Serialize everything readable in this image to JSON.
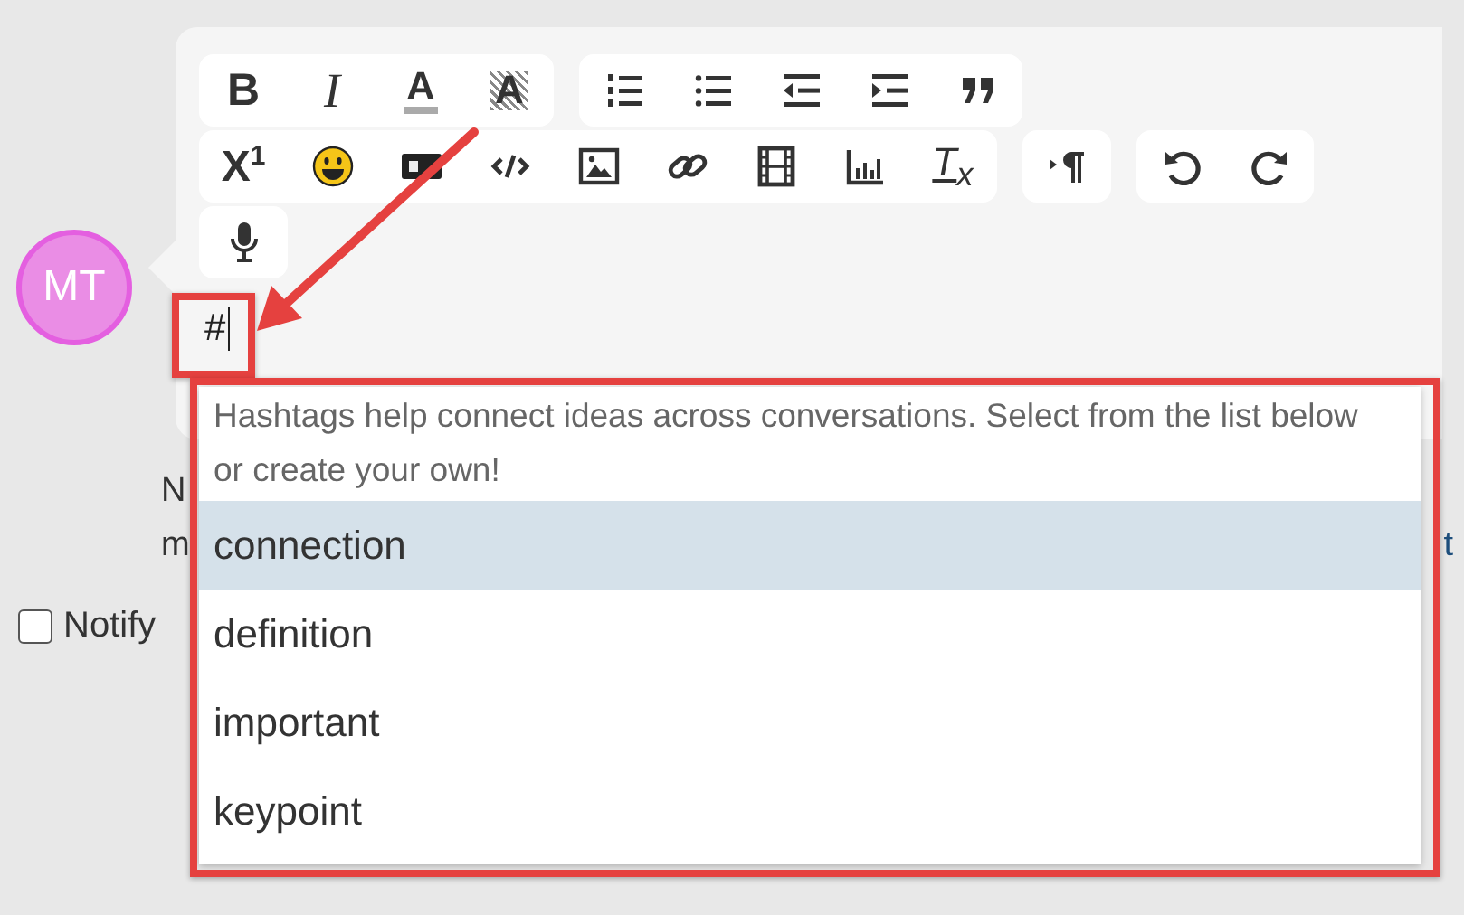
{
  "avatar": {
    "initials": "MT"
  },
  "toolbar": {
    "rows": [
      [
        {
          "buttons": [
            {
              "kind": "bold",
              "label": "B"
            },
            {
              "kind": "italic",
              "label": "I"
            },
            {
              "kind": "font-color",
              "label": "A"
            },
            {
              "kind": "highlight",
              "label": "A"
            }
          ]
        },
        {
          "buttons": [
            {
              "kind": "ordered-list"
            },
            {
              "kind": "bullet-list"
            },
            {
              "kind": "outdent"
            },
            {
              "kind": "indent"
            },
            {
              "kind": "quote"
            }
          ]
        }
      ],
      [
        {
          "buttons": [
            {
              "kind": "superscript",
              "label": "X$^{1}$"
            },
            {
              "kind": "emoji"
            },
            {
              "kind": "gif"
            },
            {
              "kind": "code"
            },
            {
              "kind": "image"
            },
            {
              "kind": "link"
            },
            {
              "kind": "video"
            },
            {
              "kind": "chart"
            },
            {
              "kind": "clear-format",
              "label": "T$_{x}$"
            }
          ]
        },
        {
          "buttons": [
            {
              "kind": "paragraph"
            }
          ]
        },
        {
          "buttons": [
            {
              "kind": "undo"
            },
            {
              "kind": "redo"
            }
          ]
        }
      ],
      [
        {
          "buttons": [
            {
              "kind": "microphone"
            }
          ]
        }
      ]
    ]
  },
  "composer": {
    "value": "#"
  },
  "background_text": {
    "line_1": "N",
    "line_2_start": "m",
    "line_2_end": "t"
  },
  "notify": {
    "label": "Notify",
    "checked": false
  },
  "hashtag_menu": {
    "hint": "Hashtags help connect ideas across conversations. Select from the list below or create your own!",
    "items": [
      {
        "label": "connection",
        "selected": true
      },
      {
        "label": "definition",
        "selected": false
      },
      {
        "label": "important",
        "selected": false
      },
      {
        "label": "keypoint",
        "selected": false
      }
    ]
  }
}
